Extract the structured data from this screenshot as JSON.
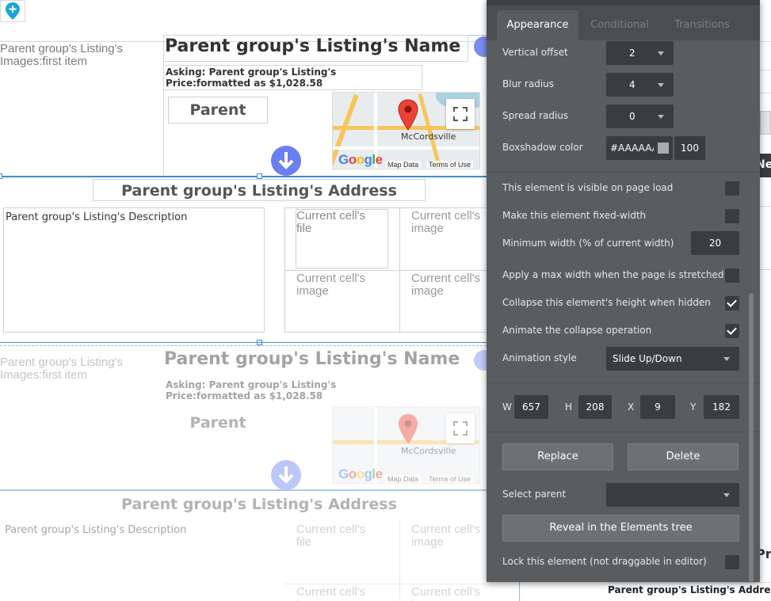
{
  "canvas": {
    "group1": {
      "image_label": "Parent group's Listing's Images:first item",
      "name": "Parent group's Listing's Name",
      "price": "Asking: Parent group's Listing's Price:formatted as $1,028.58",
      "parent_button": "Parent",
      "address": "Parent group's Listing's Address",
      "description": "Parent group's Listing's Description",
      "cells": [
        "Current cell's file",
        "Current cell's image",
        "Current cell's image",
        "Current cell's image"
      ]
    },
    "group2": {
      "image_label": "Parent group's Listing's Images:first item",
      "name": "Parent group's Listing's Name",
      "price": "Asking: Parent group's Listing's Price:formatted as $1,028.58",
      "parent_button": "Parent",
      "address": "Parent group's Listing's Address",
      "description": "Parent group's Listing's Description",
      "cells": [
        "Current cell's file",
        "Current cell's image",
        "Current cell's image",
        "Current cell's image"
      ]
    },
    "map": {
      "town": "McCordsville",
      "google": "Google",
      "map_data": "Map Data",
      "terms": "Terms of Use"
    },
    "right_edge": {
      "new_label": "New",
      "price_fragment": "Pric",
      "address_label": "Parent group's Listing's Address"
    }
  },
  "panel": {
    "tabs": [
      {
        "label": "Appearance",
        "active": true
      },
      {
        "label": "Conditional",
        "active": false
      },
      {
        "label": "Transitions",
        "active": false
      }
    ],
    "vertical_offset": {
      "label": "Vertical offset",
      "value": "2"
    },
    "blur_radius": {
      "label": "Blur radius",
      "value": "4"
    },
    "spread_radius": {
      "label": "Spread radius",
      "value": "0"
    },
    "boxshadow_color": {
      "label": "Boxshadow color",
      "hex": "#AAAAAA",
      "swatch": "#aaaaaa",
      "opacity": "100"
    },
    "visible_on_load": {
      "label": "This element is visible on page load",
      "checked": false
    },
    "fixed_width": {
      "label": "Make this element fixed-width",
      "checked": false
    },
    "min_width": {
      "label": "Minimum width (% of current width)",
      "value": "20"
    },
    "max_width": {
      "label": "Apply a max width when the page is stretched",
      "checked": false
    },
    "collapse_hidden": {
      "label": "Collapse this element's height when hidden",
      "checked": true
    },
    "animate_collapse": {
      "label": "Animate the collapse operation",
      "checked": true
    },
    "animation_style": {
      "label": "Animation style",
      "value": "Slide Up/Down"
    },
    "dims": {
      "w_label": "W",
      "w": "657",
      "h_label": "H",
      "h": "208",
      "x_label": "X",
      "x": "9",
      "y_label": "Y",
      "y": "182"
    },
    "replace_button": "Replace",
    "delete_button": "Delete",
    "select_parent": {
      "label": "Select parent",
      "value": ""
    },
    "reveal_button": "Reveal in the Elements tree",
    "lock_element": {
      "label": "Lock this element (not draggable in editor)",
      "checked": false
    }
  },
  "colors": {
    "panel_bg": "#5a5d60",
    "selection_blue": "#3b8bd8",
    "down_button": "#6b7ff0",
    "map_pin": "#ea4335"
  }
}
